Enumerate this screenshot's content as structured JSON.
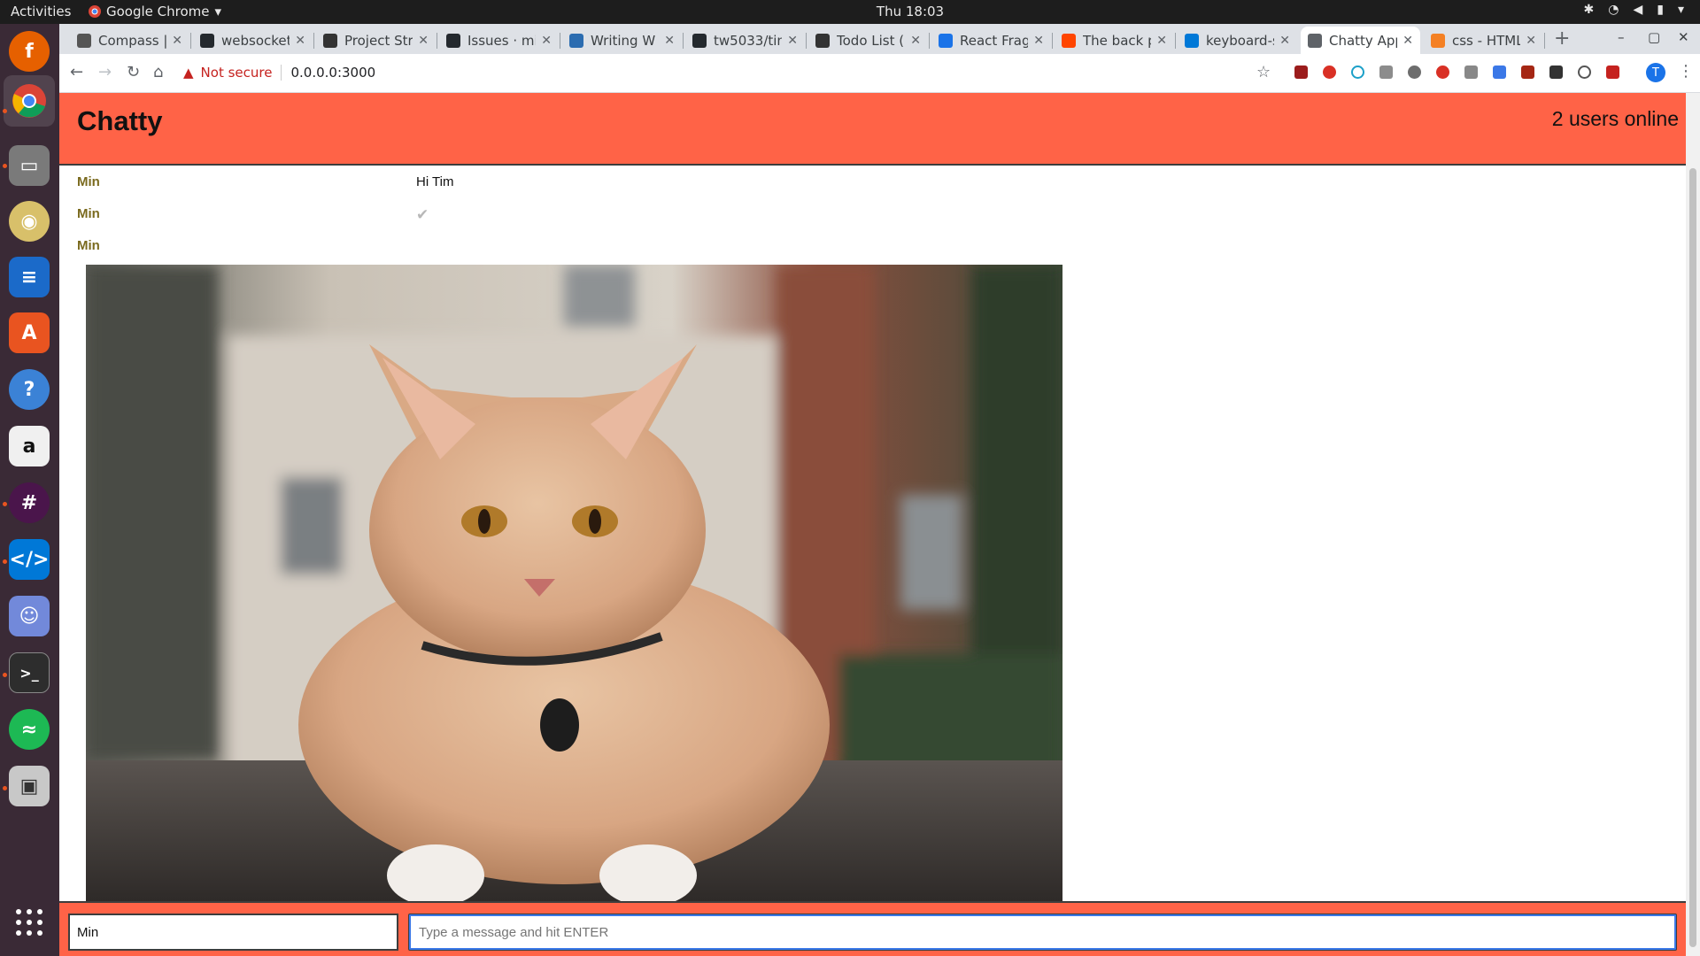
{
  "topbar": {
    "activities": "Activities",
    "app_name": "Google Chrome",
    "clock": "Thu 18:03"
  },
  "browser": {
    "tabs": [
      {
        "title": "Compass | ",
        "favicon": "compass-icon",
        "color": "#555555"
      },
      {
        "title": "websocket",
        "favicon": "github-icon",
        "color": "#24292e"
      },
      {
        "title": "Project Str",
        "favicon": "document-icon",
        "color": "#333333"
      },
      {
        "title": "Issues · mi",
        "favicon": "github-icon",
        "color": "#24292e"
      },
      {
        "title": "Writing W",
        "favicon": "book-icon",
        "color": "#2b6cb0"
      },
      {
        "title": "tw5033/tin",
        "favicon": "github-icon",
        "color": "#24292e"
      },
      {
        "title": "Todo List (",
        "favicon": "cube-icon",
        "color": "#333333"
      },
      {
        "title": "React Frag",
        "favicon": "docs-icon",
        "color": "#1a73e8"
      },
      {
        "title": "The back p",
        "favicon": "reddit-icon",
        "color": "#ff4500"
      },
      {
        "title": "keyboard-s",
        "favicon": "vscode-icon",
        "color": "#0078d7"
      },
      {
        "title": "Chatty App",
        "favicon": "globe-icon",
        "color": "#5f6368",
        "active": true
      },
      {
        "title": "css - HTML",
        "favicon": "stackoverflow-icon",
        "color": "#f48024"
      }
    ],
    "security_label": "Not secure",
    "url": "0.0.0.0:3000"
  },
  "app": {
    "brand": "Chatty",
    "users_online": "2 users online",
    "messages": [
      {
        "username": "Min",
        "content": "Hi Tim",
        "type": "text"
      },
      {
        "username": "Min",
        "content": "✔",
        "type": "emoji"
      },
      {
        "username": "Min",
        "content": "",
        "type": "image"
      }
    ],
    "chatbar": {
      "username_value": "Min",
      "message_placeholder": "Type a message and hit ENTER"
    }
  },
  "colors": {
    "accent": "#ff6347",
    "username": "#7a6a1e"
  }
}
